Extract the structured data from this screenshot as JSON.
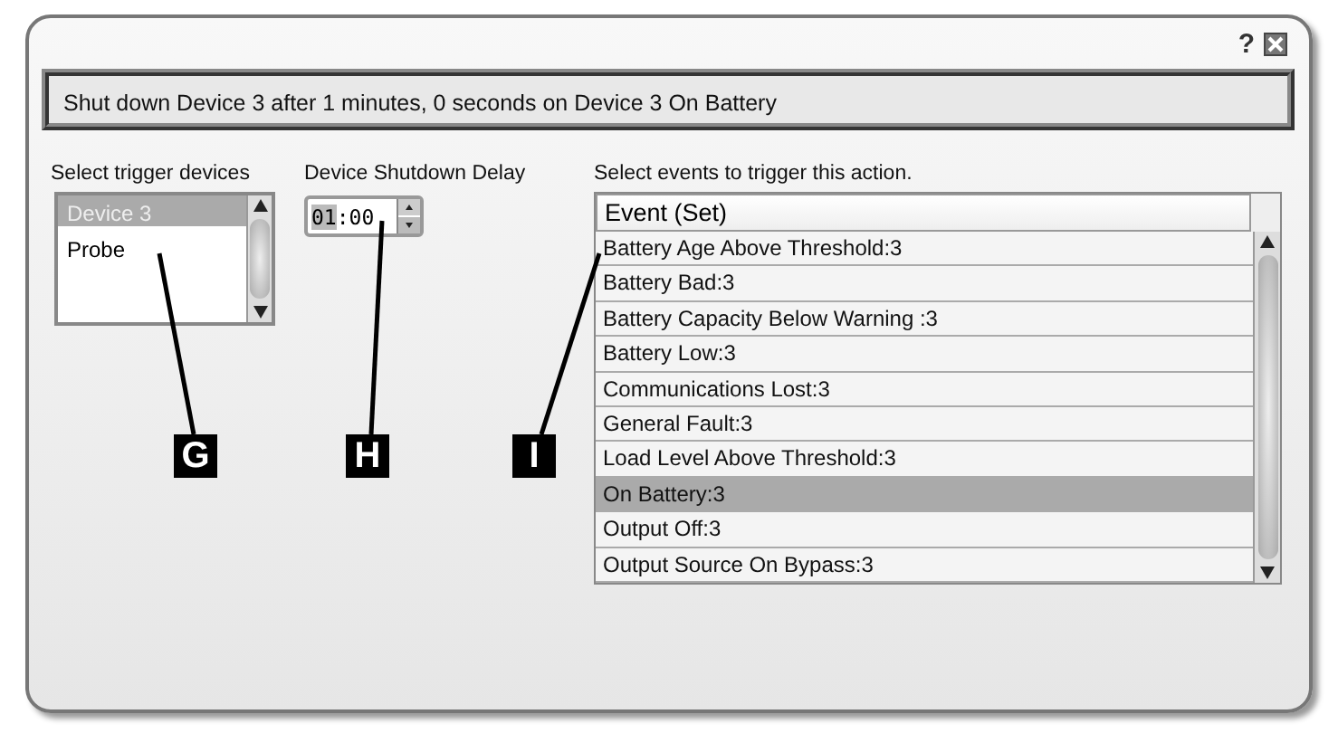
{
  "window": {
    "help": "?"
  },
  "summary": "Shut down Device 3 after 1 minutes, 0 seconds on Device 3 On Battery",
  "devices": {
    "label": "Select trigger devices",
    "items": [
      {
        "label": "Device 3",
        "selected": true
      },
      {
        "label": "Probe",
        "selected": false
      }
    ]
  },
  "delay": {
    "label": "Device Shutdown Delay",
    "hours": "01",
    "minutes": ":00"
  },
  "events": {
    "label": "Select events to trigger this action.",
    "column": "Event (Set)",
    "rows": [
      {
        "label": "Battery Age Above Threshold:3",
        "selected": false
      },
      {
        "label": "Battery Bad:3",
        "selected": false
      },
      {
        "label": "Battery Capacity Below Warning :3",
        "selected": false
      },
      {
        "label": "Battery Low:3",
        "selected": false
      },
      {
        "label": "Communications Lost:3",
        "selected": false
      },
      {
        "label": "General Fault:3",
        "selected": false
      },
      {
        "label": "Load Level Above Threshold:3",
        "selected": false
      },
      {
        "label": "On Battery:3",
        "selected": true
      },
      {
        "label": "Output Off:3",
        "selected": false
      },
      {
        "label": "Output Source On Bypass:3",
        "selected": false
      }
    ]
  },
  "callouts": [
    "G",
    "H",
    "I"
  ]
}
